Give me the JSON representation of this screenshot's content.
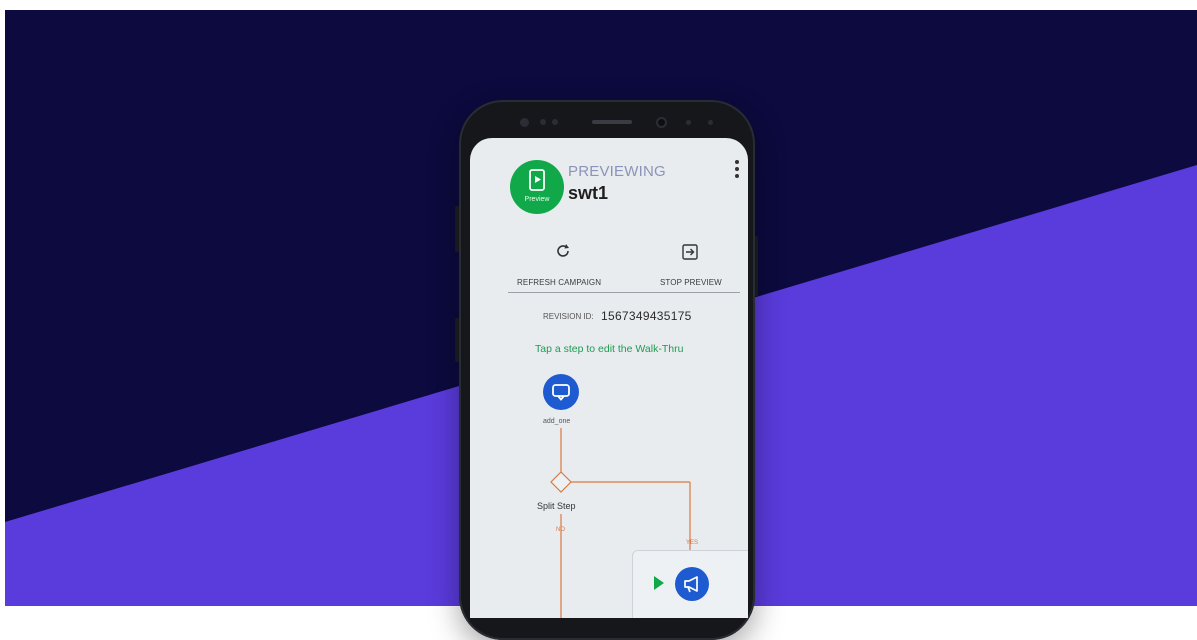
{
  "colors": {
    "background_dark": "#0c0a3e",
    "background_purple": "#5a3bdc",
    "preview_green": "#11a84a",
    "accent_blue": "#1e5bd0",
    "hint_green": "#1f9b52",
    "flow_orange": "#d9783f"
  },
  "header": {
    "avatar_label": "Preview",
    "status": "PREVIEWING",
    "campaign_name": "swt1",
    "menu_icon": "more-vert-icon"
  },
  "actions": {
    "refresh_label": "REFRESH CAMPAIGN",
    "refresh_icon": "refresh-icon",
    "stop_label": "STOP PREVIEW",
    "stop_icon": "exit-icon"
  },
  "revision": {
    "label": "REVISION ID:",
    "value": "1567349435175"
  },
  "hint": "Tap a step to edit the Walk-Thru",
  "flow": {
    "first_step_label": "add_one",
    "first_step_icon": "chat-bubble-icon",
    "split_label": "Split Step",
    "no_label": "NO",
    "yes_label": "YES"
  },
  "floating_controls": {
    "play_icon": "play-icon",
    "megaphone_icon": "megaphone-icon"
  }
}
